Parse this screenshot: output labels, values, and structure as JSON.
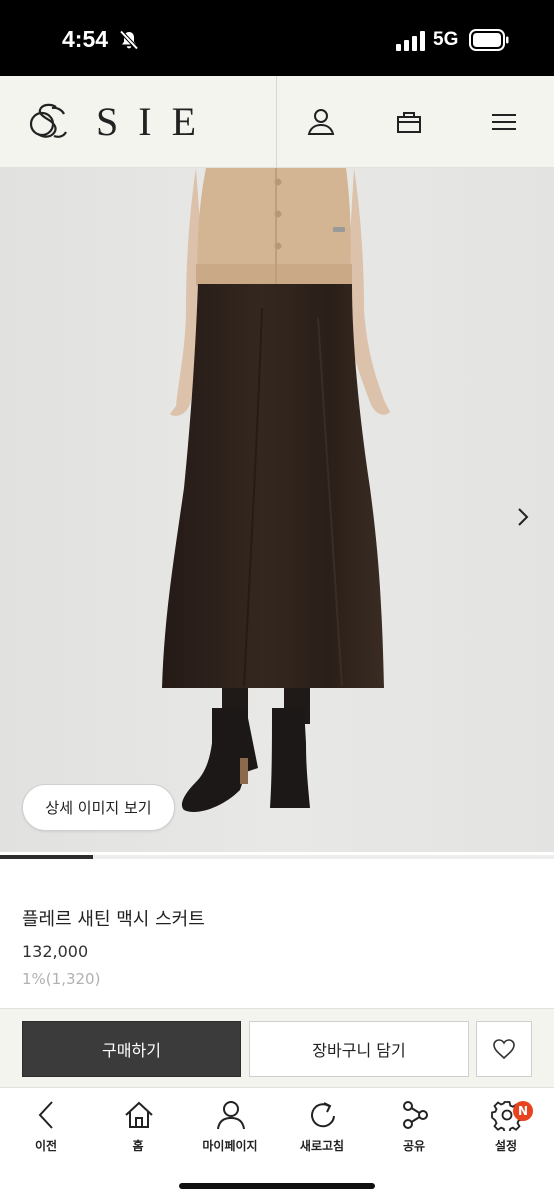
{
  "status_bar": {
    "time": "4:54",
    "network": "5G",
    "icons": [
      "bell-slash-icon",
      "signal-bars-icon",
      "battery-icon"
    ]
  },
  "header": {
    "logo_text": "SIE",
    "icons": [
      "user-icon",
      "shopping-bag-icon",
      "menu-icon"
    ]
  },
  "gallery": {
    "detail_button_label": "상세 이미지 보기",
    "next_icon": "chevron-right-icon",
    "progress": 0.167
  },
  "product": {
    "name": "플레르 새틴 맥시 스커트",
    "price": "132,000",
    "points": "1%(1,320)"
  },
  "actions": {
    "buy_label": "구매하기",
    "cart_label": "장바구니 담기",
    "wish_icon": "heart-icon"
  },
  "bottom_nav": {
    "items": [
      {
        "label": "이전",
        "icon": "back-arrow-icon"
      },
      {
        "label": "홈",
        "icon": "home-icon"
      },
      {
        "label": "마이페이지",
        "icon": "person-icon"
      },
      {
        "label": "새로고침",
        "icon": "refresh-icon"
      },
      {
        "label": "공유",
        "icon": "share-icon"
      },
      {
        "label": "설정",
        "icon": "settings-gear-icon",
        "badge": "N"
      }
    ]
  },
  "colors": {
    "header_bg": "#f4f4ef",
    "buy_button": "#3b3b3b",
    "badge": "#e8431f",
    "skirt": "#2e221d",
    "sweater": "#d3b593"
  }
}
